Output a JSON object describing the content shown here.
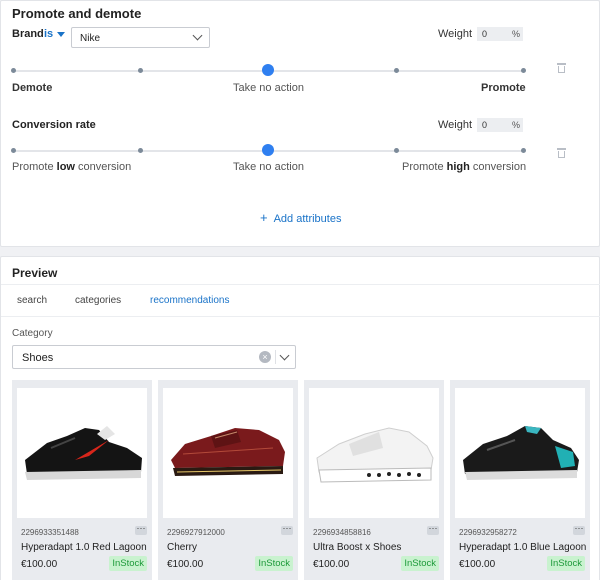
{
  "promote_demote": {
    "title": "Promote and demote",
    "add_attributes_label": "Add attributes",
    "rules": [
      {
        "attribute": "Brand",
        "operator": "is",
        "value": "Nike",
        "weight_label": "Weight",
        "weight_value": "0",
        "weight_unit": "%",
        "slider_left_label": "Demote",
        "slider_center_label": "Take no action",
        "slider_right_label": "Promote",
        "slider_position": "Take no action"
      },
      {
        "attribute": "Conversion rate",
        "weight_label": "Weight",
        "weight_value": "0",
        "weight_unit": "%",
        "slider_left_prefix": "Promote ",
        "slider_left_bold": "low",
        "slider_left_suffix": " conversion",
        "slider_center_label": "Take no action",
        "slider_right_prefix": "Promote ",
        "slider_right_bold": "high",
        "slider_right_suffix": " conversion",
        "slider_position": "Take no action"
      }
    ]
  },
  "preview": {
    "title": "Preview",
    "tabs": [
      {
        "label": "search",
        "active": false
      },
      {
        "label": "categories",
        "active": false
      },
      {
        "label": "recommendations",
        "active": true
      }
    ],
    "category_label": "Category",
    "category_value": "Shoes",
    "products": [
      {
        "id": "2296933351488",
        "name": "Hyperadapt 1.0 Red Lagoon",
        "price": "€100.00",
        "stock": "InStock",
        "image": "black sneaker with red swoosh"
      },
      {
        "id": "2296927912000",
        "name": "Cherry",
        "price": "€100.00",
        "stock": "InStock",
        "image": "cherry red leather brogue shoe"
      },
      {
        "id": "2296934858816",
        "name": "Ultra Boost x Shoes",
        "price": "€100.00",
        "stock": "InStock",
        "image": "white sneaker with leopard sole"
      },
      {
        "id": "2296932958272",
        "name": "Hyperadapt 1.0 Blue Lagoon",
        "price": "€100.00",
        "stock": "InStock",
        "image": "black sneaker with teal accents"
      }
    ],
    "more_glyph": "···"
  },
  "colors": {
    "accent": "#1a73c8",
    "slider_thumb": "#2f7ff0",
    "in_stock_bg": "#c9f2cf",
    "in_stock_text": "#1e9a3a"
  }
}
